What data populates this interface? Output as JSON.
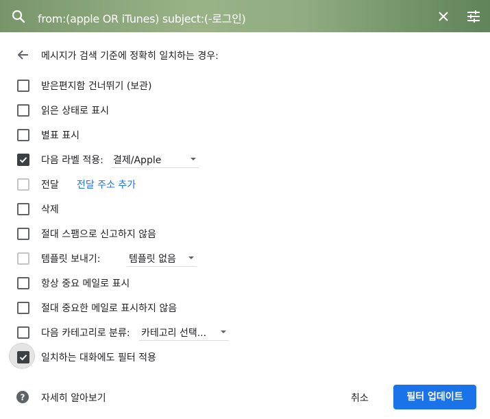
{
  "search": {
    "query": "from:(apple OR iTunes) subject:(-로그인)"
  },
  "colors": {
    "accent": "#1a73e8",
    "checkbox_checked": "#3c4043"
  },
  "icons": {
    "search": "search-icon",
    "clear": "close-icon",
    "options": "tune-icon",
    "back": "arrow-back-icon",
    "help": "help-icon"
  },
  "heading": "메시지가 검색 기준에 정확히 일치하는 경우:",
  "options": {
    "skip_inbox": {
      "label": "받은편지함 건너뛰기 (보관)",
      "checked": false
    },
    "mark_read": {
      "label": "읽은 상태로 표시",
      "checked": false
    },
    "star": {
      "label": "별표 표시",
      "checked": false
    },
    "apply_label": {
      "label": "다음 라벨 적용:",
      "checked": true,
      "selected": "결제/Apple"
    },
    "forward": {
      "label": "전달",
      "checked": false,
      "disabled": true,
      "link": "전달 주소 추가"
    },
    "delete": {
      "label": "삭제",
      "checked": false
    },
    "never_spam": {
      "label": "절대 스팸으로 신고하지 않음",
      "checked": false
    },
    "send_template": {
      "label": "템플릿 보내기:",
      "checked": false,
      "disabled": true,
      "selected": "템플릿 없음"
    },
    "always_important": {
      "label": "항상 중요 메일로 표시",
      "checked": false
    },
    "never_important": {
      "label": "절대 중요한 메일로 표시하지 않음",
      "checked": false
    },
    "categorize": {
      "label": "다음 카테고리로 분류:",
      "checked": false,
      "selected": "카테고리 선택..."
    },
    "also_apply": {
      "label": "일치하는 대화에도 필터 적용",
      "checked": true
    }
  },
  "footer": {
    "learn_more": "자세히 알아보기",
    "cancel": "취소",
    "update": "필터 업데이트"
  }
}
